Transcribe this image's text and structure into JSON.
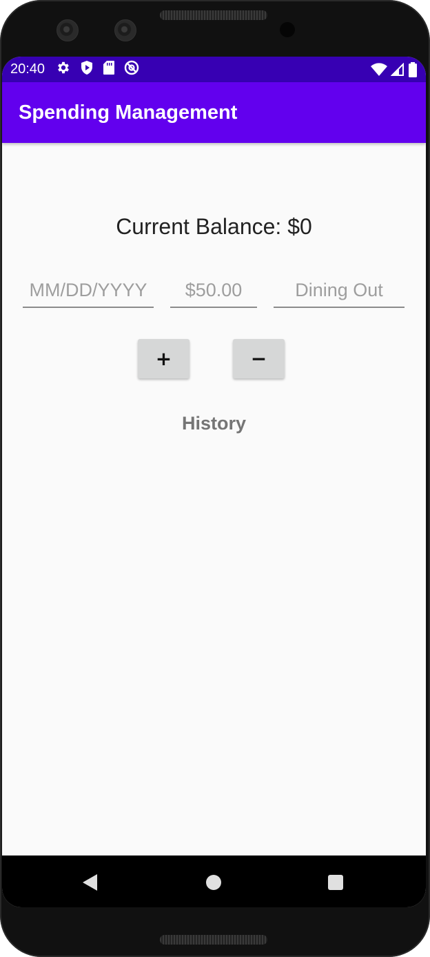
{
  "status_bar": {
    "time": "20:40",
    "left_icons": [
      "settings-icon",
      "shield-icon",
      "sd-card-icon",
      "do-not-disturb-icon"
    ],
    "right_icons": [
      "wifi-icon",
      "signal-icon",
      "battery-icon"
    ]
  },
  "app_bar": {
    "title": "Spending Management",
    "color": "#6200ee",
    "status_color": "#3700b3"
  },
  "balance": {
    "label": "Current Balance: $0"
  },
  "form": {
    "date_placeholder": "MM/DD/YYYY",
    "amount_placeholder": "$50.00",
    "category_placeholder": "Dining Out",
    "date_value": "",
    "amount_value": "",
    "category_value": ""
  },
  "actions": {
    "add_label": "+",
    "subtract_label": "−"
  },
  "history": {
    "heading": "History",
    "items": []
  },
  "nav_bar": {
    "icons": [
      "back-icon",
      "home-icon",
      "recents-icon"
    ]
  }
}
